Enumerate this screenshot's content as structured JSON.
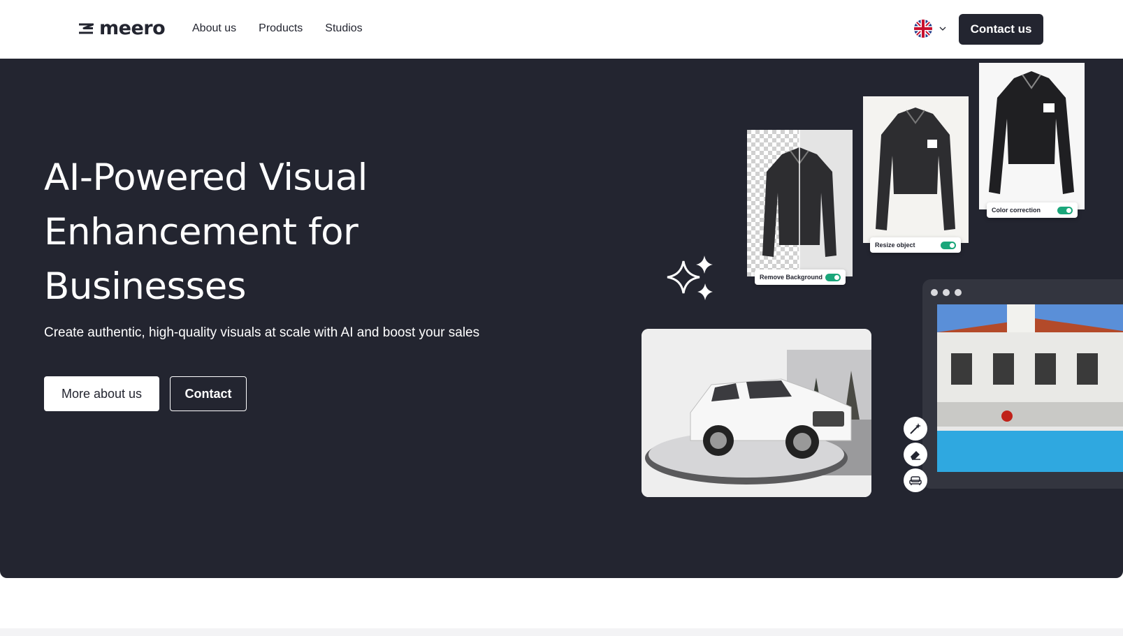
{
  "header": {
    "logo_text": "meero",
    "nav": [
      "About us",
      "Products",
      "Studios"
    ],
    "language": "English (UK)",
    "contact_label": "Contact us"
  },
  "hero": {
    "title": "AI-Powered Visual Enhancement for Businesses",
    "subtitle": "Create authentic, high-quality visuals at scale with AI and boost your sales",
    "primary_button": "More about us",
    "secondary_button": "Contact"
  },
  "features": {
    "remove_background": "Remove Background",
    "resize_object": "Resize object",
    "color_correction": "Color correction"
  },
  "tools": [
    "magic-wand-icon",
    "eraser-icon",
    "sofa-icon"
  ],
  "colors": {
    "dark": "#232530",
    "accent": "#1aa67a",
    "white": "#ffffff"
  }
}
